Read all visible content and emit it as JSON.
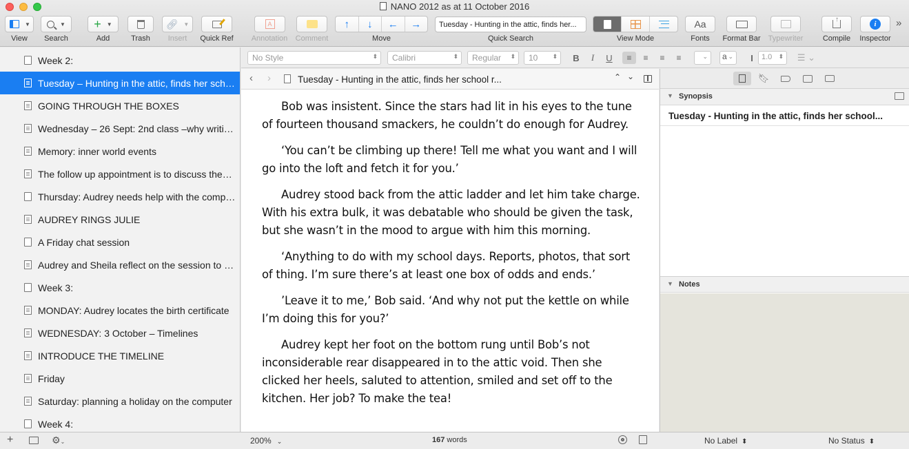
{
  "window": {
    "title": "NANO 2012 as at 11 October 2016"
  },
  "toolbar": {
    "view": "View",
    "search": "Search",
    "add": "Add",
    "trash": "Trash",
    "insert": "Insert",
    "quick_ref": "Quick Ref",
    "annotation": "Annotation",
    "comment": "Comment",
    "move": "Move",
    "quick_search": "Quick Search",
    "quick_search_value": "Tuesday - Hunting in the attic, finds her...",
    "view_mode": "View Mode",
    "fonts": "Fonts",
    "fonts_glyph": "Aa",
    "format_bar": "Format Bar",
    "typewriter": "Typewriter",
    "compile": "Compile",
    "inspector": "Inspector",
    "overflow": "»"
  },
  "format_bar": {
    "style": "No Style",
    "font": "Calibri",
    "weight": "Regular",
    "size": "10",
    "bold": "B",
    "italic": "I",
    "underline": "U",
    "text_color": "a",
    "line_spacing": "1.0"
  },
  "binder": {
    "items": [
      {
        "label": "Week 2:",
        "icon": "folder",
        "selected": false
      },
      {
        "label": "Tuesday – Hunting in the attic, finds her school r…",
        "icon": "doc",
        "selected": true
      },
      {
        "label": "GOING THROUGH THE BOXES",
        "icon": "doc",
        "selected": false
      },
      {
        "label": "Wednesday – 26 Sept: 2nd class –why writing…",
        "icon": "doc",
        "selected": false
      },
      {
        "label": "Memory: inner world events",
        "icon": "doc",
        "selected": false
      },
      {
        "label": "The follow up appointment is to discuss the…",
        "icon": "doc",
        "selected": false
      },
      {
        "label": "Thursday: Audrey needs help with the compu…",
        "icon": "folder",
        "selected": false
      },
      {
        "label": "AUDREY RINGS JULIE",
        "icon": "doc",
        "selected": false
      },
      {
        "label": "A Friday chat session",
        "icon": "folder",
        "selected": false
      },
      {
        "label": "Audrey and Sheila reflect on the session to d…",
        "icon": "doc",
        "selected": false
      },
      {
        "label": "Week 3:",
        "icon": "folder",
        "selected": false
      },
      {
        "label": "MONDAY: Audrey locates the birth certificate",
        "icon": "doc",
        "selected": false
      },
      {
        "label": "WEDNESDAY: 3 October – Timelines",
        "icon": "doc",
        "selected": false
      },
      {
        "label": "INTRODUCE THE TIMELINE",
        "icon": "doc",
        "selected": false
      },
      {
        "label": "Friday",
        "icon": "doc",
        "selected": false
      },
      {
        "label": "Saturday: planning a holiday on the computer",
        "icon": "doc",
        "selected": false
      },
      {
        "label": "Week 4:",
        "icon": "folder",
        "selected": false
      }
    ]
  },
  "editor": {
    "header_title": "Tuesday - Hunting in the attic, finds her school r...",
    "paragraphs": [
      "Bob was insistent. Since the stars had lit in his eyes to the tune of fourteen thousand smackers, he couldn’t do enough for Audrey.",
      "‘You can’t be climbing up there! Tell me what you want and I will go into the loft and fetch it for you.’",
      "Audrey stood back from the attic ladder and let him take charge. With his extra bulk, it was debatable who should be given the task, but she wasn’t in the mood to argue with him this morning.",
      "‘Anything to do with my school days. Reports, photos, that sort of thing. I’m sure there’s at least one box of odds and ends.’",
      "’Leave it to me,’ Bob said. ‘And why not put the kettle on while I’m doing this for you?’",
      "Audrey kept her foot on the bottom rung until Bob’s not inconsiderable rear disappeared in to the attic void. Then she clicked her heels, saluted to attention, smiled and set off to the kitchen. Her job? To make the tea!"
    ],
    "zoom": "200%",
    "word_count": "167",
    "words_label": "words"
  },
  "inspector": {
    "synopsis_label": "Synopsis",
    "synopsis_title": "Tuesday - Hunting in the attic, finds her school...",
    "notes_label": "Notes",
    "label_select": "No Label",
    "status_select": "No Status"
  }
}
